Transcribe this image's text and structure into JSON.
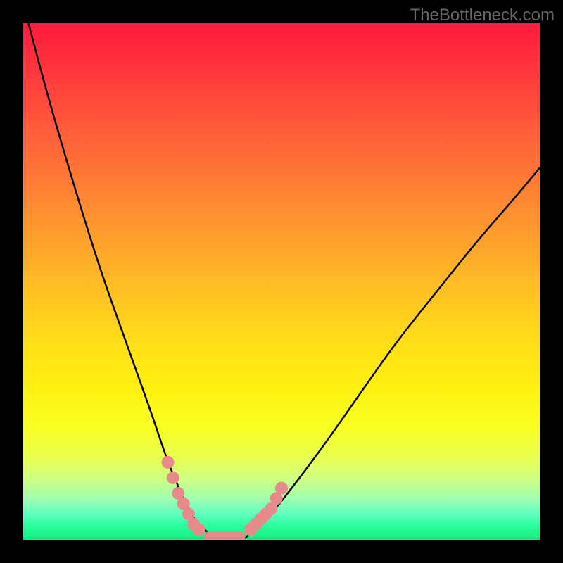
{
  "watermark": "TheBottleneck.com",
  "chart_data": {
    "type": "line",
    "title": "",
    "xlabel": "",
    "ylabel": "",
    "xlim": [
      0,
      100
    ],
    "ylim": [
      0,
      100
    ],
    "series": [
      {
        "name": "left-curve",
        "x": [
          1,
          5,
          10,
          15,
          20,
          25,
          28,
          31,
          33,
          35,
          37.5
        ],
        "y": [
          100,
          85,
          68,
          52,
          38,
          24,
          15,
          8,
          4,
          2,
          0
        ]
      },
      {
        "name": "right-curve",
        "x": [
          42.5,
          45,
          48,
          52,
          58,
          65,
          72,
          80,
          88,
          95,
          100
        ],
        "y": [
          0,
          2,
          5,
          10,
          18,
          28,
          38,
          48,
          58,
          66,
          72
        ]
      }
    ],
    "markers": {
      "left_cluster": [
        {
          "x": 28,
          "y": 15
        },
        {
          "x": 29,
          "y": 12
        },
        {
          "x": 30,
          "y": 9
        },
        {
          "x": 31,
          "y": 7
        },
        {
          "x": 32,
          "y": 5
        },
        {
          "x": 33,
          "y": 3
        },
        {
          "x": 34,
          "y": 2
        }
      ],
      "right_cluster": [
        {
          "x": 44,
          "y": 2
        },
        {
          "x": 45,
          "y": 3
        },
        {
          "x": 46,
          "y": 4
        },
        {
          "x": 47,
          "y": 5
        },
        {
          "x": 48,
          "y": 6
        },
        {
          "x": 49,
          "y": 8
        },
        {
          "x": 50,
          "y": 10
        }
      ],
      "bottom_bar": {
        "x_start": 35,
        "x_end": 43,
        "y": 0.5
      }
    },
    "marker_color": "#e88a8a",
    "curve_color": "#000000",
    "background_gradient": {
      "type": "rainbow",
      "top": "#ff1a3d",
      "bottom": "#10ef80"
    }
  }
}
